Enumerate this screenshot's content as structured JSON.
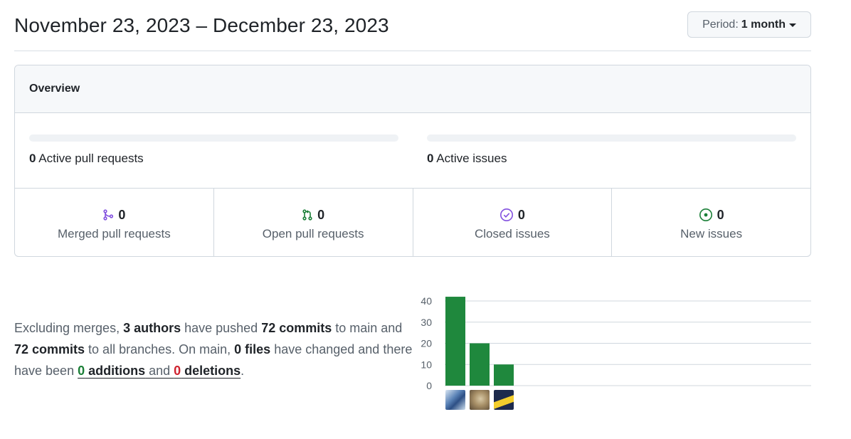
{
  "header": {
    "date_range": "November 23, 2023 – December 23, 2023",
    "period_label": "Period:",
    "period_value": "1 month"
  },
  "overview": {
    "title": "Overview",
    "active_pull_requests": {
      "count": "0",
      "label": "Active pull requests"
    },
    "active_issues": {
      "count": "0",
      "label": "Active issues"
    },
    "stats": [
      {
        "count": "0",
        "label": "Merged pull requests",
        "icon": "git-merge-icon",
        "color": "#8250df"
      },
      {
        "count": "0",
        "label": "Open pull requests",
        "icon": "git-pull-request-icon",
        "color": "#1a7f37"
      },
      {
        "count": "0",
        "label": "Closed issues",
        "icon": "issue-closed-icon",
        "color": "#8250df"
      },
      {
        "count": "0",
        "label": "New issues",
        "icon": "issue-opened-icon",
        "color": "#1a7f37"
      }
    ]
  },
  "summary": {
    "t1": "Excluding merges, ",
    "authors": "3 authors",
    "t2": " have pushed ",
    "commits_main": "72 commits",
    "t3": " to main and ",
    "commits_all": "72 commits",
    "t4": " to all branches. On main, ",
    "files": "0 files",
    "t5": " have changed and there have been ",
    "additions_count": "0",
    "additions_label": " additions",
    "t6": " and ",
    "deletions_count": "0",
    "deletions_label": " deletions",
    "t7": "."
  },
  "chart_data": {
    "type": "bar",
    "categories": [
      "author-1",
      "author-2",
      "author-3"
    ],
    "values": [
      42,
      20,
      10
    ],
    "ylim": [
      0,
      40
    ],
    "yticks": [
      "0",
      "10",
      "20",
      "30",
      "40"
    ],
    "bar_color": "#1f883d",
    "grid": true
  }
}
